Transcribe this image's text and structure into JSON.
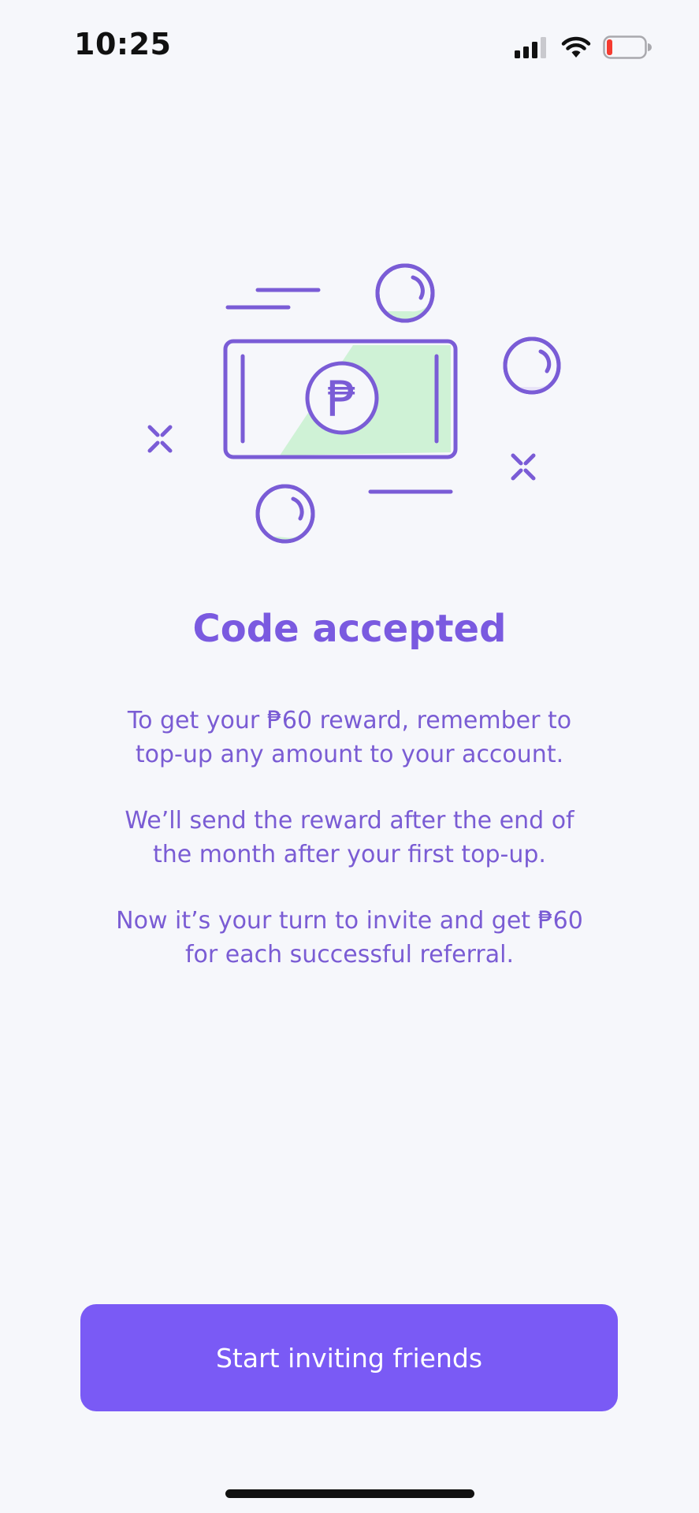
{
  "status_bar": {
    "time": "10:25",
    "icons": [
      "cellular-signal-icon",
      "wifi-icon",
      "battery-low-icon"
    ]
  },
  "illustration": {
    "icon": "banknote-peso-icon",
    "currency_symbol": "₱",
    "colors": {
      "stroke": "#7A5CD6",
      "fill": "#CFF2D6"
    }
  },
  "content": {
    "title": "Code accepted",
    "paragraphs": [
      {
        "line1": "To get your ₱60 reward, remember to",
        "line2": "top-up any amount to your account."
      },
      {
        "line1": "We’ll send the reward after the end of",
        "line2": "the month after your first top-up."
      },
      {
        "line1": "Now it’s your turn to invite and get ₱60",
        "line2": "for each successful referral."
      }
    ]
  },
  "cta": {
    "label": "Start inviting friends"
  },
  "colors": {
    "accent": "#7A5AF5",
    "text_purple": "#7A5CD4",
    "background": "#F6F7FB"
  }
}
